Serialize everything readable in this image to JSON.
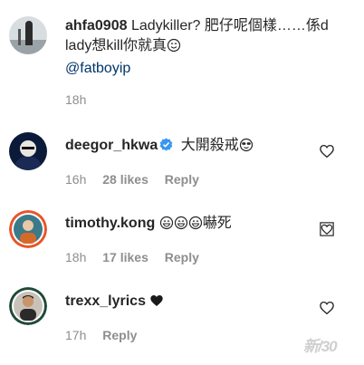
{
  "comments": [
    {
      "username": "ahfa0908",
      "text": "Ladykiller? 肥仔呢個樣……係d lady想kill你就真",
      "mention": "@fatboyip",
      "time": "18h"
    },
    {
      "username": "deegor_hkwa",
      "verified": true,
      "text": "大開殺戒",
      "time": "16h",
      "likes": "28 likes",
      "reply": "Reply"
    },
    {
      "username": "timothy.kong",
      "text": "嚇死",
      "time": "18h",
      "likes": "17 likes",
      "reply": "Reply"
    },
    {
      "username": "trexx_lyrics",
      "time": "17h",
      "reply": "Reply"
    }
  ],
  "icons": {
    "like": "heart-outline-icon",
    "verified": "verified-badge-icon",
    "trexx_text": "black-heart-icon"
  },
  "colors": {
    "verified_blue": "#3897f0",
    "mention": "#003569",
    "meta_gray": "#8e8e8e"
  },
  "watermark": "新/30"
}
